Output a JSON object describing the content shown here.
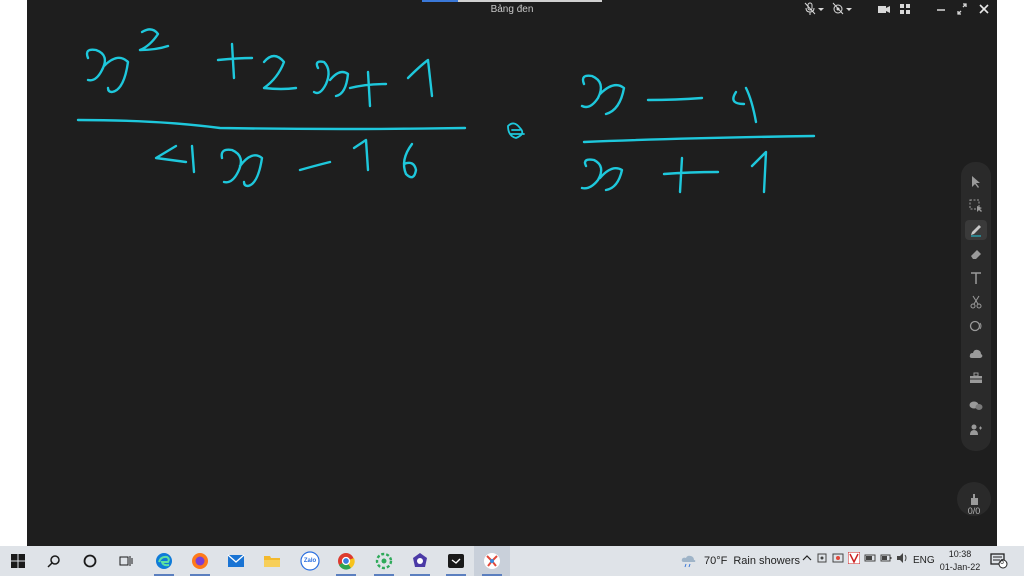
{
  "window": {
    "title": "Bảng đen"
  },
  "colors": {
    "board": "#1e1e1e",
    "ink": "#1ec8dc",
    "taskbar": "#dfe3e8"
  },
  "toolbar_icons": [
    "mic-off-icon",
    "dropdown-icon",
    "camera-off-icon",
    "dropdown-icon",
    "video-icon",
    "grid-icon",
    "minimize-icon",
    "restore-icon",
    "close-icon"
  ],
  "tools": [
    "select-icon",
    "area-select-icon",
    "pen-icon",
    "eraser-icon",
    "text-icon",
    "scissors-icon",
    "shape-icon",
    "cloud-icon",
    "toolbox-icon",
    "chat-icon",
    "participants-icon"
  ],
  "page_counter": "0/0",
  "taskbar": {
    "apps": [
      "start-icon",
      "search-icon",
      "cortana-icon",
      "task-view-icon",
      "edge-icon",
      "firefox-icon",
      "mail-icon",
      "file-explorer-icon",
      "zalo-icon",
      "chrome-icon",
      "app-icon",
      "app-icon",
      "capture-icon",
      "whiteboard-app-icon"
    ],
    "zalo_label": "Zalo",
    "weather": {
      "temp": "70°F",
      "condition": "Rain showers"
    },
    "language": "ENG",
    "time": "10:38",
    "date": "01-Jan-22",
    "notification_count": "6"
  }
}
